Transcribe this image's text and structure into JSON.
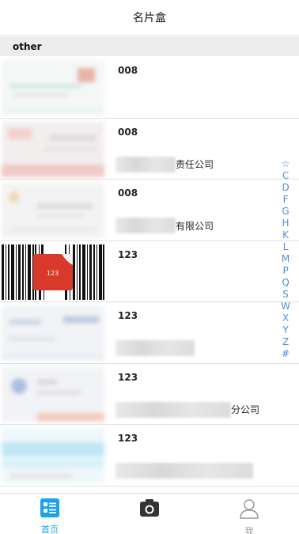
{
  "header": {
    "title": "名片盒"
  },
  "section": {
    "label": "other"
  },
  "cards": [
    {
      "name": "008",
      "company_suffix": ""
    },
    {
      "name": "008",
      "company_suffix": "责任公司"
    },
    {
      "name": "008",
      "company_suffix": "有限公司"
    },
    {
      "name": "123",
      "company_suffix": "",
      "barcode_label": "123"
    },
    {
      "name": "123",
      "company_suffix": ""
    },
    {
      "name": "123",
      "company_suffix": "分公司"
    },
    {
      "name": "123",
      "company_suffix": ""
    }
  ],
  "index": [
    "☆",
    "C",
    "D",
    "F",
    "G",
    "H",
    "K",
    "L",
    "M",
    "P",
    "Q",
    "S",
    "W",
    "X",
    "Y",
    "Z",
    "#"
  ],
  "tabbar": {
    "home_label": "首页",
    "camera_label": "",
    "me_label": "我",
    "active_color": "#1aa3e8",
    "inactive_color": "#999999"
  }
}
